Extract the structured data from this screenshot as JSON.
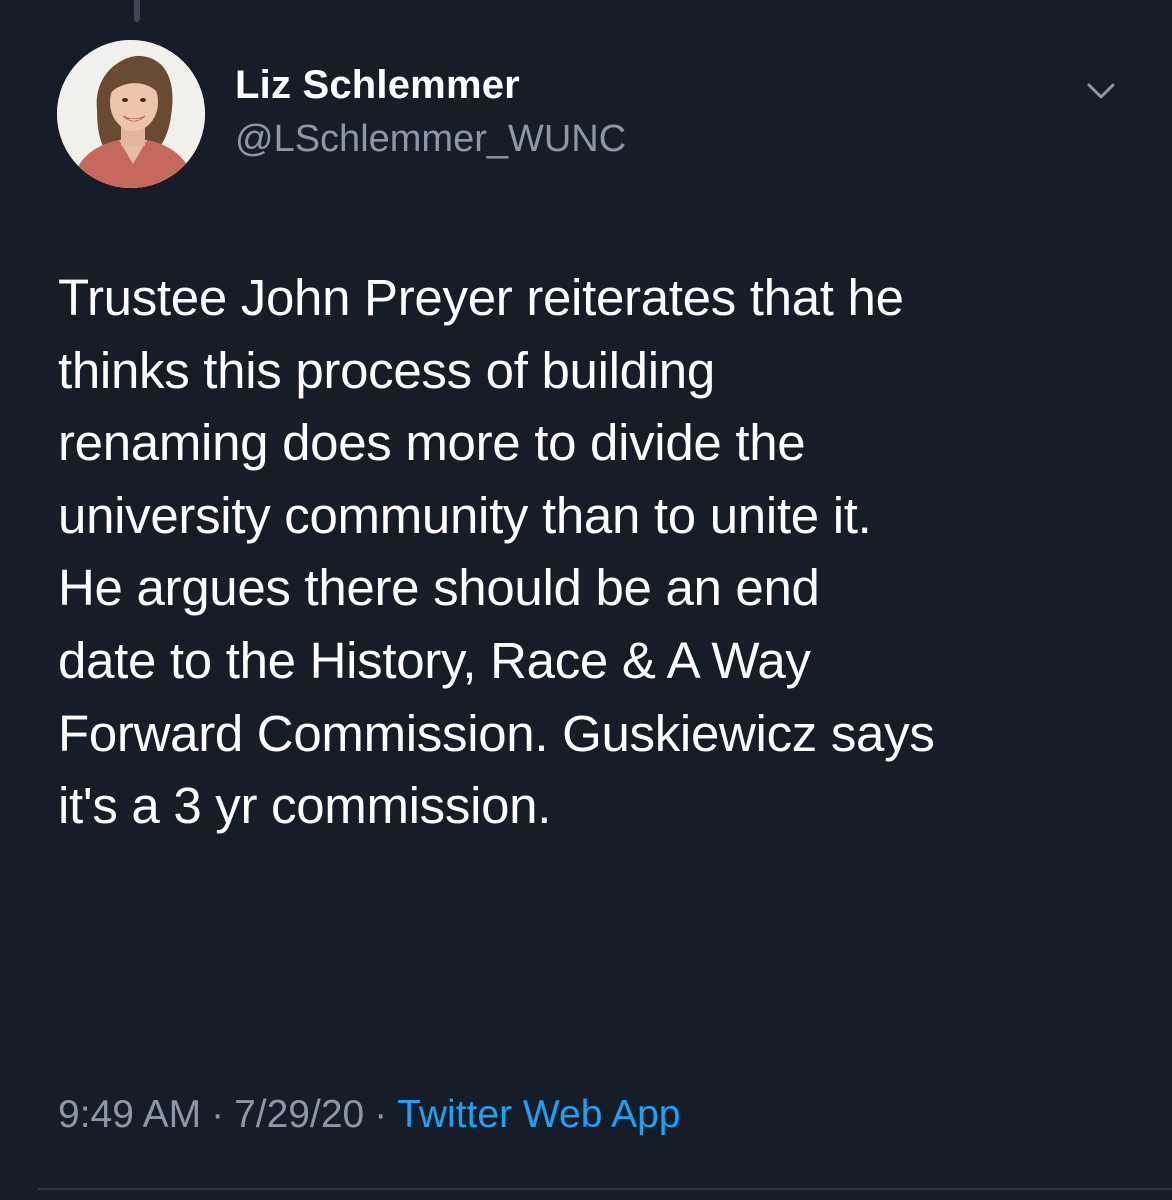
{
  "tweet": {
    "author": {
      "display_name": "Liz Schlemmer",
      "handle": "@LSchlemmer_WUNC",
      "avatar_icon": "profile-photo"
    },
    "menu_icon": "chevron-down-icon",
    "text": "Trustee John Preyer reiterates that he\nthinks this process of building\nrenaming does more to divide the\nuniversity community than to unite it.\nHe argues there should be an end\ndate to the History, Race & A Way\nForward Commission. Guskiewicz says\nit's a 3 yr commission.",
    "time": "9:49 AM",
    "separator": "·",
    "date": "7/29/20",
    "source": "Twitter Web App"
  },
  "colors": {
    "background": "#161c28",
    "text": "#ffffff",
    "secondary_text": "#8b98a5",
    "link": "#1da1f2"
  }
}
